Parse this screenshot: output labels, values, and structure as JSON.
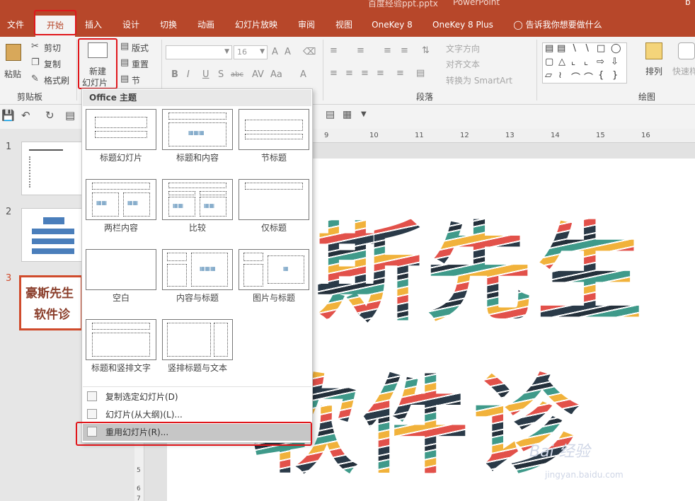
{
  "window": {
    "title": "百度经验ppt.pptx",
    "app": "PowerPoint",
    "user": "b"
  },
  "tabs": [
    {
      "label": "文件"
    },
    {
      "label": "开始"
    },
    {
      "label": "插入"
    },
    {
      "label": "设计"
    },
    {
      "label": "切换"
    },
    {
      "label": "动画"
    },
    {
      "label": "幻灯片放映"
    },
    {
      "label": "审阅"
    },
    {
      "label": "视图"
    },
    {
      "label": "OneKey 8"
    },
    {
      "label": "OneKey 8 Plus"
    }
  ],
  "tell_me": "告诉我你想要做什么",
  "ribbon": {
    "clipboard": {
      "paste": "粘贴",
      "cut": "剪切",
      "copy": "复制",
      "format_painter": "格式刷",
      "group": "剪贴板"
    },
    "slides": {
      "new_slide_line1": "新建",
      "new_slide_line2": "幻灯片",
      "layout": "版式",
      "reset": "重置",
      "section": "节"
    },
    "font": {
      "size": "16"
    },
    "paragraph": {
      "text_direction": "文字方向",
      "align_text": "对齐文本",
      "convert_smartart": "转换为 SmartArt",
      "group": "段落"
    },
    "drawing": {
      "arrange": "排列",
      "quick_styles": "快速样",
      "group": "绘图"
    }
  },
  "slides_panel": {
    "numbers": [
      "1",
      "2",
      "3"
    ],
    "thumb3_line1": "豪斯先生",
    "thumb3_line2": "软件诊"
  },
  "ruler": {
    "h_marks": [
      "9",
      "10",
      "11",
      "12",
      "13",
      "14",
      "15",
      "16"
    ],
    "v_marks": [
      "5",
      "6",
      "7"
    ]
  },
  "slide_text": {
    "line1": "斯先生",
    "line2": "软件诊"
  },
  "dropdown": {
    "header": "Office 主题",
    "layouts": [
      {
        "label": "标题幻灯片"
      },
      {
        "label": "标题和内容"
      },
      {
        "label": "节标题"
      },
      {
        "label": "两栏内容"
      },
      {
        "label": "比较"
      },
      {
        "label": "仅标题"
      },
      {
        "label": "空白"
      },
      {
        "label": "内容与标题"
      },
      {
        "label": "图片与标题"
      },
      {
        "label": "标题和竖排文字"
      },
      {
        "label": "竖排标题与文本"
      }
    ],
    "items": [
      {
        "label": "复制选定幻灯片(D)"
      },
      {
        "label": "幻灯片(从大纲)(L)..."
      },
      {
        "label": "重用幻灯片(R)..."
      }
    ]
  },
  "watermark": {
    "brand": "Bai 经验",
    "url": "jingyan.baidu.com"
  },
  "colors": {
    "accent": "#b7472a",
    "highlight_box": "#e0161b"
  }
}
